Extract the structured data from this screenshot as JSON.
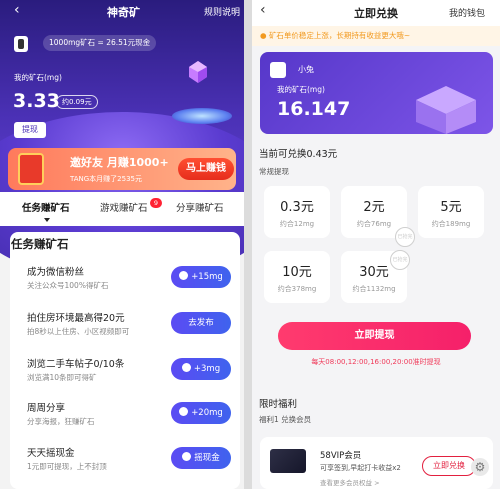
{
  "left": {
    "nav": {
      "back_icon": "‹",
      "title": "神奇矿",
      "rules": "规则说明"
    },
    "rate_text": "1000mg矿石 = 26.51元现金",
    "my_ore_label": "我的矿石(mg)",
    "my_ore_value": "3.33",
    "yuan_value": "约0.09元",
    "withdraw_label": "提现",
    "banner": {
      "title": "邀好友 月赚1000+",
      "subtitle": "TANG本月赚了2535元",
      "cta": "马上赚钱"
    },
    "tabs": [
      {
        "label": "任务赚矿石",
        "active": true
      },
      {
        "label": "游戏赚矿石",
        "badge": "9"
      },
      {
        "label": "分享赚矿石"
      }
    ],
    "task_section_title": "任务赚矿石",
    "tasks": [
      {
        "name": "成为微信粉丝",
        "desc": "关注公众号100%得矿石",
        "button": "+15mg",
        "icon": true
      },
      {
        "name": "拍住房环境最高得20元",
        "desc": "拍8秒以上住房、小区视频即可",
        "button": "去发布",
        "icon": false
      },
      {
        "name": "浏览二手车帖子0/10条",
        "desc": "浏览满10条即可得矿",
        "button": "+3mg",
        "icon": true
      },
      {
        "name": "周周分享",
        "desc": "分享海报，狂赚矿石",
        "button": "+20mg",
        "icon": true
      },
      {
        "name": "天天摇现金",
        "desc": "1元即可提现，上不封顶",
        "button": "摇现金",
        "icon": true
      }
    ]
  },
  "right": {
    "nav": {
      "back_icon": "‹",
      "title": "立即兑换",
      "wallet": "我的钱包"
    },
    "notice": "矿石单价稳定上涨，长期持有收益更大哦~",
    "notice_icon": "warning-icon",
    "card": {
      "user_name": "小兔",
      "label": "我的矿石(mg)",
      "value": "16.147"
    },
    "exchangeable_prefix": "当前可兑换",
    "exchangeable_value": "0.43元",
    "section_label": "常规提现",
    "options": [
      {
        "amount": "0.3元",
        "sub": "约合12mg"
      },
      {
        "amount": "2元",
        "sub": "约合76mg"
      },
      {
        "amount": "5元",
        "sub": "约合189mg"
      },
      {
        "amount": "10元",
        "sub": "约合378mg"
      },
      {
        "amount": "30元",
        "sub": "约合1132mg"
      }
    ],
    "stamp_text": "已抢完",
    "withdraw_button": "立即提现",
    "withdraw_note": "每天08:00,12:00,16:00,20:00准时提现",
    "benefits_title": "限时福利",
    "benefits_sub": "福利1 兑换会员",
    "vip": {
      "name": "58VIP会员",
      "desc": "可享签到,早起打卡收益x2",
      "link": "查看更多会员权益 >",
      "button": "立即兑换"
    },
    "settings_icon": "⚙"
  },
  "colors": {
    "purple": "#4b31b6",
    "task_button": "#4a57f1",
    "withdraw_red": "#f5206a",
    "notice_orange": "#f29a20"
  }
}
